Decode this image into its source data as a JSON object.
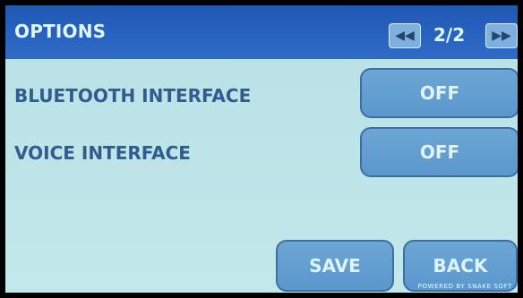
{
  "header": {
    "title": "OPTIONS",
    "page_indicator": "2/2"
  },
  "options": [
    {
      "label": "BLUETOOTH INTERFACE",
      "value": "OFF"
    },
    {
      "label": "VOICE INTERFACE",
      "value": "OFF"
    }
  ],
  "footer": {
    "save_label": "SAVE",
    "back_label": "BACK",
    "powered_by": "POWERED BY SNAKE SOFT"
  },
  "colors": {
    "header": "#1f58b3",
    "background": "#bde4e8",
    "button": "#5c97cc",
    "label": "#315c8f"
  },
  "icons": {
    "prev": "double-chevron-left-icon",
    "next": "double-chevron-right-icon"
  }
}
